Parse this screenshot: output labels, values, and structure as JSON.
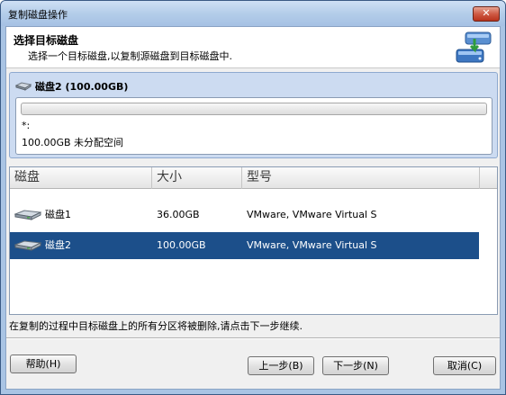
{
  "window": {
    "title": "复制磁盘操作",
    "close_label": "✕"
  },
  "header": {
    "title": "选择目标磁盘",
    "subtitle": "选择一个目标磁盘,以复制源磁盘到目标磁盘中."
  },
  "disk_panel": {
    "title": "磁盘2 (100.00GB)",
    "partition_label": "*:",
    "partition_info": "100.00GB 未分配空间"
  },
  "table": {
    "columns": [
      "磁盘",
      "大小",
      "型号"
    ],
    "rows": [
      {
        "name": "磁盘1",
        "size": "36.00GB",
        "model": "VMware, VMware Virtual S",
        "selected": false
      },
      {
        "name": "磁盘2",
        "size": "100.00GB",
        "model": "VMware, VMware Virtual S",
        "selected": true
      }
    ]
  },
  "status_text": "在复制的过程中目标磁盘上的所有分区将被删除,请点击下一步继续.",
  "buttons": {
    "help": "帮助(H)",
    "back": "上一步(B)",
    "next": "下一步(N)",
    "cancel": "取消(C)"
  },
  "colors": {
    "selection": "#1c4f8a",
    "panel": "#ccdbf1"
  }
}
